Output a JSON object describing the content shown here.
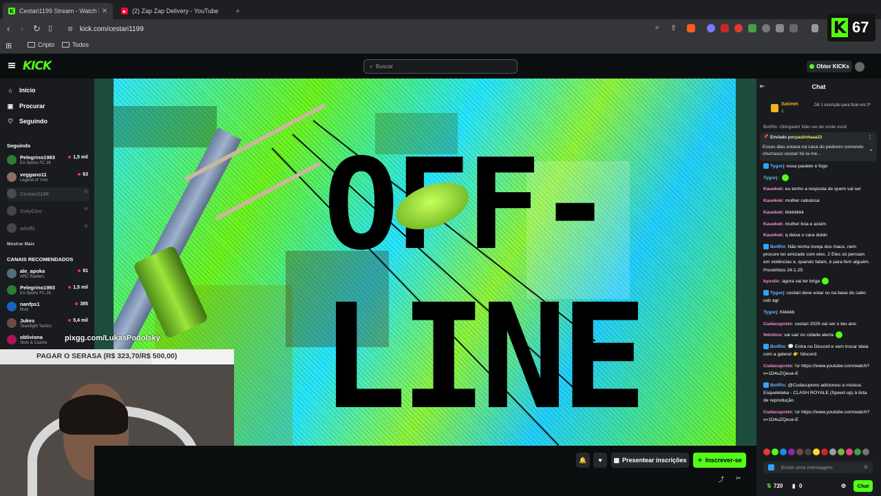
{
  "browser": {
    "tabs": [
      {
        "label": "Cestari1199 Stream - Watch Live",
        "icon": "kick-icon",
        "color": "#53fc18"
      },
      {
        "label": "(2) Zap Zap Delivery - YouTube",
        "icon": "youtube-icon",
        "color": "#ff0033"
      }
    ],
    "url": "kick.com/cestari1199",
    "bookmarks": [
      "Cripto",
      "Todos"
    ],
    "overlay_count": "67"
  },
  "header": {
    "logo": "KICK",
    "search_placeholder": "Buscar",
    "obter_label": "Obter KICKs"
  },
  "sidebar": {
    "nav": [
      {
        "label": "Início",
        "icon": "home-icon"
      },
      {
        "label": "Procurar",
        "icon": "browse-icon"
      },
      {
        "label": "Seguindo",
        "icon": "heart-icon"
      }
    ],
    "following_title": "Seguindo",
    "following": [
      {
        "name": "Pelegrino1993",
        "game": "EA Sports FC 26",
        "viewers": "1,5 mil",
        "avatar_color": "#2e7d32",
        "online": true
      },
      {
        "name": "veggano11",
        "game": "Legend of Ymir",
        "viewers": "63",
        "avatar_color": "#8d6e63",
        "online": true
      },
      {
        "name": "Cestari1199",
        "game": "",
        "viewers": "",
        "avatar_color": "#888",
        "online": false
      },
      {
        "name": "OnlyCiro",
        "game": "",
        "viewers": "",
        "avatar_color": "#888",
        "online": false
      },
      {
        "name": "adolfz",
        "game": "",
        "viewers": "",
        "avatar_color": "#888",
        "online": false
      }
    ],
    "show_more": "Mostrar Mais",
    "recommended_title": "CANAIS RECOMENDADOS",
    "recommended": [
      {
        "name": "ale_apoka",
        "game": "ARC Raiders",
        "viewers": "91",
        "avatar_color": "#546e7a"
      },
      {
        "name": "Pelegrino1993",
        "game": "EA Sports FC 26",
        "viewers": "1,5 mil",
        "avatar_color": "#2e7d32"
      },
      {
        "name": "nanfps1",
        "game": "Rust",
        "viewers": "385",
        "avatar_color": "#1565c0"
      },
      {
        "name": "Jukes",
        "game": "Teamfight Tactics",
        "viewers": "5,4 mil",
        "avatar_color": "#6d4c41"
      },
      {
        "name": "obliviona",
        "game": "Slots & Casino",
        "viewers": "",
        "avatar_color": "#ad1457"
      }
    ]
  },
  "player": {
    "offline_line1": "OFF-",
    "offline_line2": "LINE"
  },
  "overlay": {
    "pix_url": "pixgg.com/LukasPodolsky",
    "goal_text": "PAGAR O SERASA (R$ 323,70/R$ 500,00)",
    "goal_progress": 0.647
  },
  "controls": {
    "gift_label": "Presentear inscrições",
    "subscribe_label": "Inscrever-se"
  },
  "chat": {
    "title": "Chat",
    "sub_user": "Xaiimm",
    "sub_count": "1",
    "sub_cta": "Dê 1 inscrição para ficar em 2º",
    "top_cut": "BotRix: Obrigado! Não sei de onde você",
    "pinned_by_label": "Enviado por",
    "pinned_by": "paulinhaaa23",
    "pinned_text": "Esses dias estava na casa do pedreiro comendo churrasco cestari foi la me...",
    "messages": [
      {
        "user": "Tygorj",
        "color": "#6cb6ff",
        "text": "essa paulete é fogo",
        "badge": true
      },
      {
        "user": "Tygorj",
        "color": "#6cb6ff",
        "text": "",
        "badge": false,
        "emote": true
      },
      {
        "user": "Kauekek",
        "color": "#ff8ad0",
        "text": "eu tenho a resposta de quem vai ser",
        "badge": false
      },
      {
        "user": "Kauekek",
        "color": "#ff8ad0",
        "text": "mulher cabulosa",
        "badge": false
      },
      {
        "user": "Kauekek",
        "color": "#ff8ad0",
        "text": "kkkkkkkk",
        "badge": false
      },
      {
        "user": "Kauekek",
        "color": "#ff8ad0",
        "text": "mulher boa e assim",
        "badge": false
      },
      {
        "user": "Kauekek",
        "color": "#ff8ad0",
        "text": "q deixa o cara doido",
        "badge": false
      },
      {
        "user": "BotRix",
        "color": "#6cb6ff",
        "text": "Não tenha inveja dos maus, nem procure ter amizade com eles. 2 Eles só pensam em violências e, quando falam, é para ferir alguém. Provérbios 24:1-25",
        "badge": true
      },
      {
        "user": "kyustic",
        "color": "#ff8ad0",
        "text": "agora vai ter briga",
        "badge": false,
        "emote": true
      },
      {
        "user": "Tygorj",
        "color": "#6cb6ff",
        "text": "cestari deve estar so na base do cabo usb agr",
        "badge": true
      },
      {
        "user": "Tygorj",
        "color": "#6cb6ff",
        "text": "Kkkkkk",
        "badge": false
      },
      {
        "user": "Cudacupreto",
        "color": "#ff8ad0",
        "text": "cestari 2025 vai ser o teu ano",
        "badge": false
      },
      {
        "user": "fetinhos",
        "color": "#ff8ad0",
        "text": "vai sair no cidade alerta",
        "badge": false,
        "emote": true
      },
      {
        "user": "BotRix",
        "color": "#6cb6ff",
        "text": "💬 Entra no Discord e vem trocar ideia com a galera! 👉 !discord",
        "badge": true
      },
      {
        "user": "Cudacupreto",
        "color": "#ff8ad0",
        "text": "!sr https://www.youtube.com/watch?v=1D4uZQeue-E",
        "badge": false
      },
      {
        "user": "BotRix",
        "color": "#6cb6ff",
        "text": "@Cudacupreto adicionou a música: Esqueleteka - CLASH ROYALE (Speed up) à lista de reprodução.",
        "badge": true
      },
      {
        "user": "Cudacupreto",
        "color": "#ff8ad0",
        "text": "!sr https://www.youtube.com/watch?v=1D4uZQeue-E",
        "badge": false
      }
    ],
    "input_placeholder": "Envie uma mensagem",
    "points": "720",
    "zero": "0",
    "send_label": "Chat"
  }
}
